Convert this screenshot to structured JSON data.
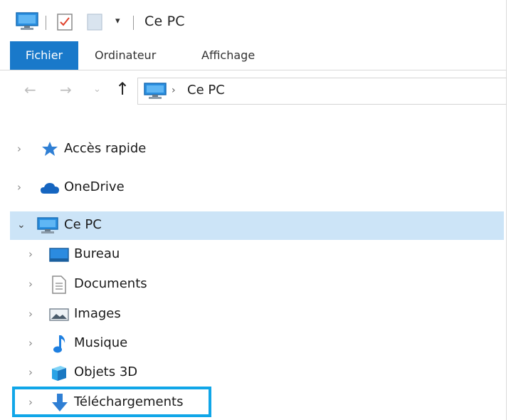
{
  "window": {
    "title": "Ce PC",
    "quick_access_icons": [
      "computer-icon",
      "properties-icon",
      "new-folder-icon",
      "customize-dropdown-icon"
    ]
  },
  "ribbon": {
    "tabs": [
      {
        "label": "Fichier",
        "active": true
      },
      {
        "label": "Ordinateur",
        "active": false
      },
      {
        "label": "Affichage",
        "active": false
      }
    ],
    "file_tab_color": "#1979ca"
  },
  "address_bar": {
    "back_glyph": "←",
    "forward_glyph": "→",
    "recent_glyph": "⌄",
    "up_glyph": "↑",
    "separator": "›",
    "path": "Ce PC"
  },
  "nav_tree": {
    "quick_access": {
      "label": "Accès rapide",
      "expanded": false
    },
    "onedrive": {
      "label": "OneDrive",
      "expanded": false
    },
    "this_pc": {
      "label": "Ce PC",
      "expanded": true,
      "selected": true,
      "children": [
        {
          "label": "Bureau",
          "icon": "desktop-icon"
        },
        {
          "label": "Documents",
          "icon": "documents-icon"
        },
        {
          "label": "Images",
          "icon": "pictures-icon"
        },
        {
          "label": "Musique",
          "icon": "music-icon"
        },
        {
          "label": "Objets 3D",
          "icon": "3d-objects-icon"
        },
        {
          "label": "Téléchargements",
          "icon": "downloads-icon",
          "highlighted": true
        }
      ]
    }
  },
  "colors": {
    "selection": "#cce4f7",
    "highlight_border": "#10a6e8",
    "accent": "#1979ca"
  }
}
